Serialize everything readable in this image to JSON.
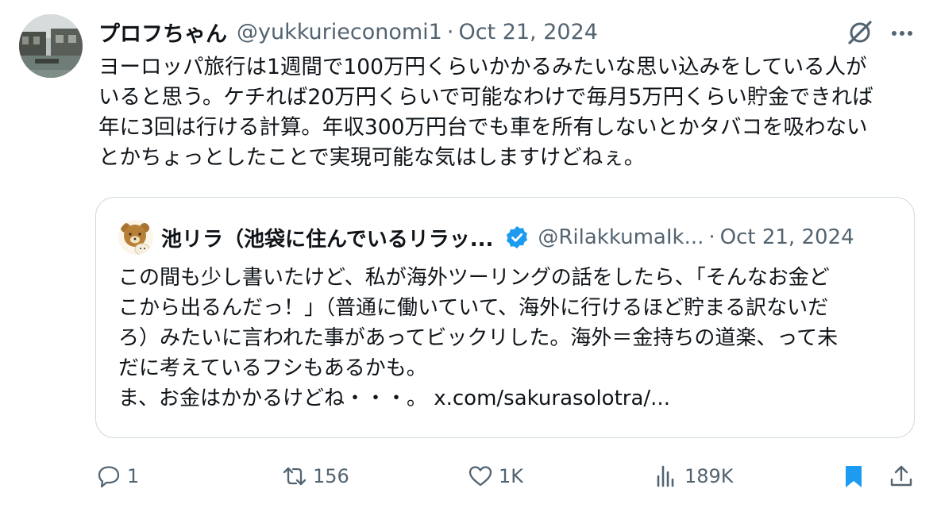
{
  "tweet": {
    "author_name": "プロフちゃん",
    "author_handle": "@yukkurieconomi1",
    "separator": "·",
    "date": "Oct 21, 2024",
    "text": "ヨーロッパ旅行は1週間で100万円くらいかかるみたいな思い込みをしている人が\nいると思う。ケチれば20万円くらいで可能なわけで毎月5万円くらい貯金できれば\n年に3回は行ける計算。年収300万円台でも車を所有しないとかタバコを吸わない\nとかちょっとしたことで実現可能な気はしますけどねぇ。"
  },
  "quoted_tweet": {
    "author_name": "池リラ（池袋に住んでいるリラッ...",
    "author_handle": "@RilakkumaIk...",
    "separator": "·",
    "date": "Oct 21, 2024",
    "text": "この間も少し書いたけど、私が海外ツーリングの話をしたら、「そんなお金ど\nこから出るんだっ！」（普通に働いていて、海外に行けるほど貯まる訳ないだ\nろ）みたいに言われた事があってビックリした。海外＝金持ちの道楽、って未\nだに考えているフシもあるかも。\nま、お金はかかるけどね・・・。 x.com/sakurasolotra/..."
  },
  "actions": {
    "reply_count": "1",
    "retweet_count": "156",
    "like_count": "1K",
    "view_count": "189K"
  },
  "colors": {
    "text": "#0f1419",
    "secondary": "#536471",
    "accent": "#1d9bf0",
    "border": "#cfd9de"
  },
  "icons": [
    "grok-icon",
    "more-icon",
    "verified-badge-icon",
    "reply-icon",
    "retweet-icon",
    "like-icon",
    "views-icon",
    "bookmark-icon",
    "share-icon"
  ]
}
